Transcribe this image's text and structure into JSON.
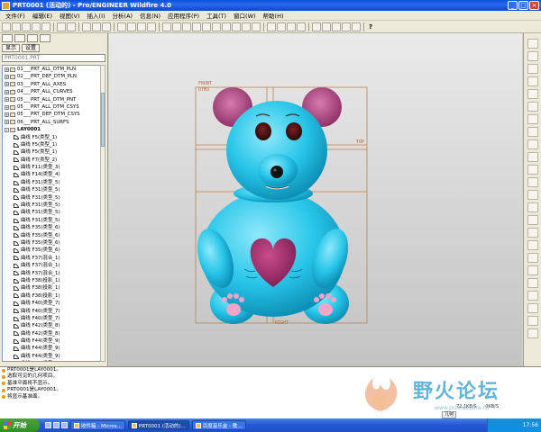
{
  "window": {
    "title": "PRT0001 (活动的) - Pro/ENGINEER Wildfire 4.0"
  },
  "menu": [
    "文件(F)",
    "编辑(E)",
    "视图(V)",
    "插入(I)",
    "分析(A)",
    "信息(N)",
    "应用程序(P)",
    "工具(T)",
    "窗口(W)",
    "帮助(H)"
  ],
  "toolbar": {
    "help_label": "?"
  },
  "left_panel": {
    "buttons": [
      "显示",
      "设置"
    ],
    "search_text": "PRT0001.PRT",
    "tree_top": [
      "01___PRT_ALL_DTM_PLN",
      "02___PRT_DEF_DTM_PLN",
      "03___PRT_ALL_AXES",
      "04___PRT_ALL_CURVES",
      "05___PRT_ALL_DTM_PNT",
      "05___PRT_ALL_DTM_CSYS",
      "05___PRT_DEF_DTM_CSYS",
      "06___PRT_ALL_SURFS"
    ],
    "part_node": "LAY0001",
    "tree_children": [
      "曲线 F5(类型_1)",
      "曲线 F5(类型_1)",
      "曲线 F5(类型_1)",
      "曲线 F7(类型_2)",
      "曲线 F11(类型_3)",
      "曲线 F14(类型_4)",
      "曲线 F31(类型_5)",
      "曲线 F31(类型_5)",
      "曲线 F31(类型_5)",
      "曲线 F31(类型_5)",
      "曲线 F31(类型_5)",
      "曲线 F31(类型_5)",
      "曲线 F35(类型_6)",
      "曲线 F35(类型_6)",
      "曲线 F35(类型_6)",
      "曲线 F35(类型_6)",
      "曲线 F37(混合_1)",
      "曲线 F37(混合_1)",
      "曲线 F37(混合_1)",
      "曲线 F38(投影_1)",
      "曲线 F38(投影_1)",
      "曲线 F38(投影_1)",
      "曲线 F40(类型_7)",
      "曲线 F40(类型_7)",
      "曲线 F40(类型_7)",
      "曲线 F42(类型_8)",
      "曲线 F42(类型_8)",
      "曲线 F44(类型_9)",
      "曲线 F44(类型_9)",
      "曲线 F44(类型_9)",
      "曲线 F44(类型_9)"
    ]
  },
  "viewport": {
    "labels": {
      "front": "FRONT",
      "dtm": "DTM3",
      "top": "TOP",
      "right": "RIGHT"
    },
    "colors": {
      "body": "#28c6e8",
      "ear_inner": "#c04c88",
      "heart": "#a02a6c",
      "paw_pad": "#f2a6c8",
      "datum": "#c08048"
    }
  },
  "messages": [
    "PRT0001是LAY0001。",
    "选取可见的几何项目。",
    "基准平面将不显示。",
    "PRT0001是LAY0001。",
    "将显示基准面。"
  ],
  "status": {
    "filter": "几何",
    "speed": "72.1KB/S",
    "speed2": "0KB/S"
  },
  "watermark": {
    "text": "野火论坛",
    "url": "www.proewildfire.cn"
  },
  "taskbar": {
    "start": "开始",
    "tasks": [
      "收件箱 - Micros...",
      "PRT0001 (活动的)...",
      "百度音乐盒 - 歌..."
    ],
    "clock": "17:56"
  }
}
